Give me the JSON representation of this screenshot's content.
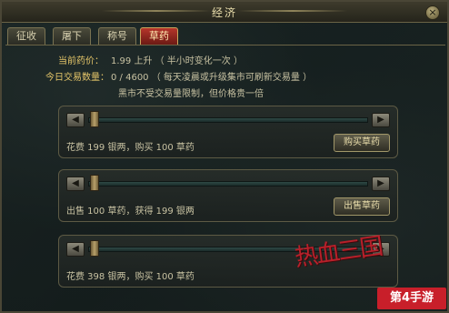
{
  "window": {
    "title": "经济",
    "close_label": "×"
  },
  "tabs": [
    {
      "label": "征收",
      "active": false
    },
    {
      "label": "屠下",
      "active": false
    },
    {
      "label": "称号",
      "active": false
    },
    {
      "label": "草药",
      "active": true
    }
  ],
  "info": {
    "price_label": "当前药价：",
    "price_value": "1.99 上升 （ 半小时变化一次 ）",
    "volume_label": "今日交易数量：",
    "volume_value": "0 / 4600 （ 每天凌晨或升级集市可刷新交易量 ）",
    "notice": "黑市不受交易量限制，但价格贵一倍"
  },
  "panels": [
    {
      "cost": "花费 199 银两，购买 100 草药",
      "button": "购买草药",
      "level": 0
    },
    {
      "cost": "出售 100 草药，获得 199 银两",
      "button": "出售草药",
      "level": 0
    },
    {
      "cost": "花费 398 银两，购买 100 草药",
      "button": "",
      "level": 0
    }
  ],
  "icons": {
    "left": "◀",
    "right": "▶"
  },
  "watermark": {
    "logo": "热血三国",
    "site": "第4手游"
  }
}
